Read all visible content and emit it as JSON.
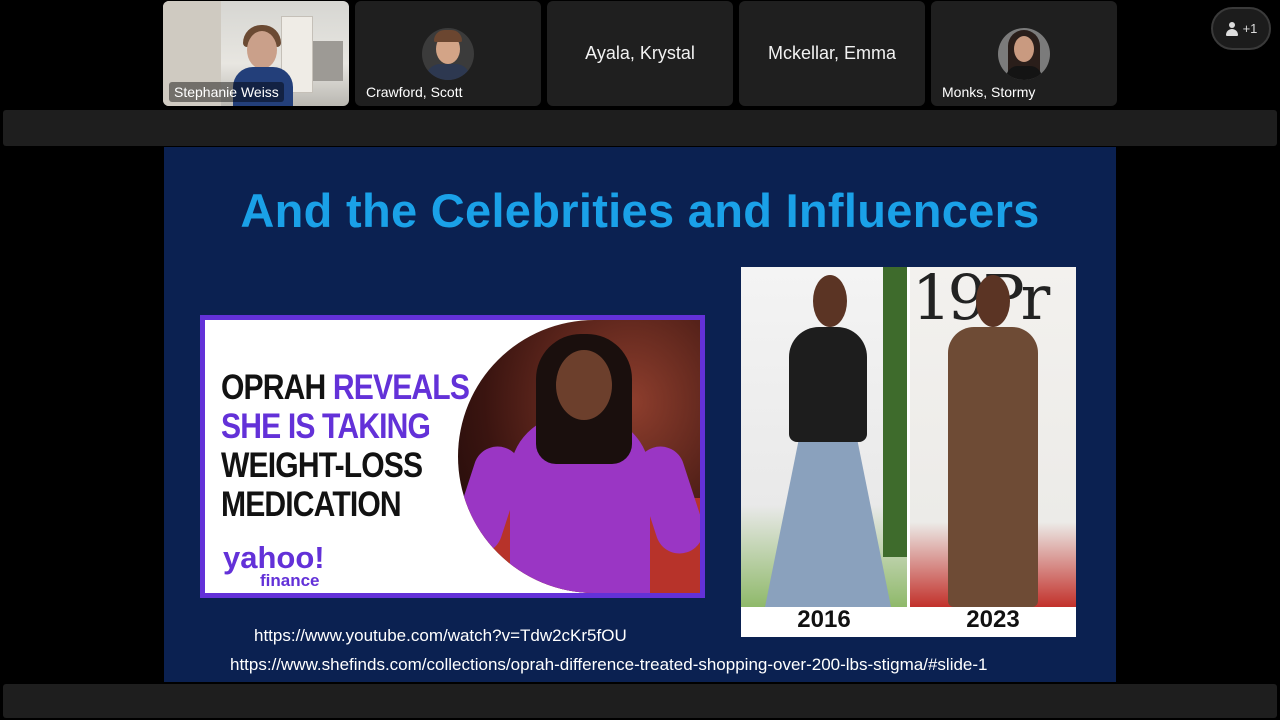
{
  "participants": [
    {
      "name": "Stephanie Weiss",
      "type": "video"
    },
    {
      "name": "Crawford, Scott",
      "type": "avatar"
    },
    {
      "name": "Ayala, Krystal",
      "type": "text"
    },
    {
      "name": "Mckellar, Emma",
      "type": "text"
    },
    {
      "name": "Monks, Stormy",
      "type": "avatar"
    }
  ],
  "people_button": {
    "label": "+1"
  },
  "slide": {
    "title": "And the Celebrities and Influencers",
    "news_card": {
      "headline_line1_plain": "OPRAH ",
      "headline_line1_accent": "REVEALS",
      "headline_line2": "SHE IS TAKING",
      "headline_line3": "WEIGHT-LOSS",
      "headline_line4": "MEDICATION",
      "logo_top": "yahoo!",
      "logo_bottom": "finance"
    },
    "compare": {
      "left_year": "2016",
      "right_year": "2023",
      "backdrop_text": "19Pr"
    },
    "links": [
      "https://www.youtube.com/watch?v=Tdw2cKr5fOU",
      "https://www.shefinds.com/collections/oprah-difference-treated-shopping-over-200-lbs-stigma/#slide-1"
    ]
  },
  "colors": {
    "slide_bg": "#0b2151",
    "title": "#1aa1e8",
    "yahoo_purple": "#6331d8"
  }
}
